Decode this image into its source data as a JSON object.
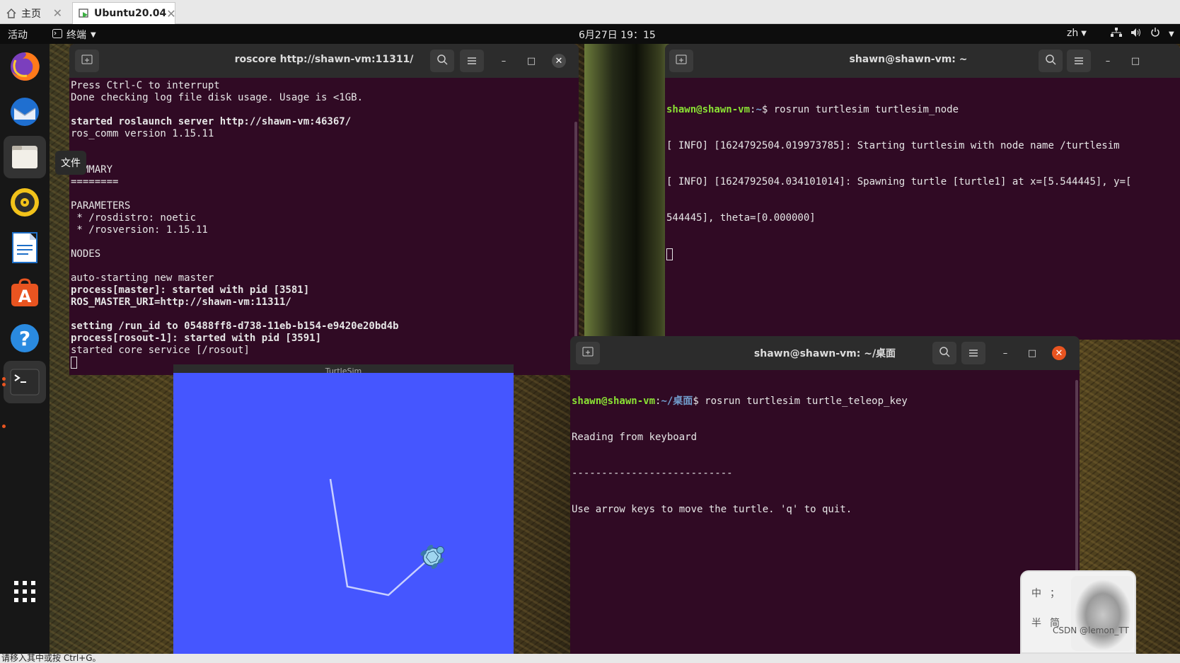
{
  "host_tabs": {
    "home_label": "主页",
    "vm_label": "Ubuntu20.04",
    "close_glyph": "✕"
  },
  "topbar": {
    "activities": "活动",
    "app_menu": "终端",
    "clock": "6月27日  19：15",
    "input_method": "zh"
  },
  "dock": {
    "tooltip": "文件",
    "items": [
      "firefox-icon",
      "thunderbird-icon",
      "files-icon",
      "rhythmbox-icon",
      "libreoffice-writer-icon",
      "ubuntu-software-icon",
      "help-icon",
      "terminal-icon",
      "show-applications-icon"
    ]
  },
  "term_roscore": {
    "title": "roscore http://shawn-vm:11311/",
    "lines": [
      {
        "t": "Press Ctrl-C to interrupt",
        "b": false
      },
      {
        "t": "Done checking log file disk usage. Usage is <1GB.",
        "b": false
      },
      {
        "t": "",
        "b": false
      },
      {
        "t": "started roslaunch server http://shawn-vm:46367/",
        "b": true
      },
      {
        "t": "ros_comm version 1.15.11",
        "b": false
      },
      {
        "t": "",
        "b": false
      },
      {
        "t": "",
        "b": false
      },
      {
        "t": "SUMMARY",
        "b": false
      },
      {
        "t": "========",
        "b": false
      },
      {
        "t": "",
        "b": false
      },
      {
        "t": "PARAMETERS",
        "b": false
      },
      {
        "t": " * /rosdistro: noetic",
        "b": false
      },
      {
        "t": " * /rosversion: 1.15.11",
        "b": false
      },
      {
        "t": "",
        "b": false
      },
      {
        "t": "NODES",
        "b": false
      },
      {
        "t": "",
        "b": false
      },
      {
        "t": "auto-starting new master",
        "b": false
      },
      {
        "t": "process[master]: started with pid [3581]",
        "b": true
      },
      {
        "t": "ROS_MASTER_URI=http://shawn-vm:11311/",
        "b": true
      },
      {
        "t": "",
        "b": false
      },
      {
        "t": "setting /run_id to 05488ff8-d738-11eb-b154-e9420e20bd4b",
        "b": true
      },
      {
        "t": "process[rosout-1]: started with pid [3591]",
        "b": true
      },
      {
        "t": "started core service [/rosout]",
        "b": false
      }
    ]
  },
  "term_node": {
    "title": "shawn@shawn-vm: ~",
    "prompt_user": "shawn@shawn-vm",
    "prompt_sep": ":",
    "prompt_path": "~",
    "prompt_end": "$ ",
    "command": "rosrun turtlesim turtlesim_node",
    "lines": [
      "[ INFO] [1624792504.019973785]: Starting turtlesim with node name /turtlesim",
      "[ INFO] [1624792504.034101014]: Spawning turtle [turtle1] at x=[5.544445], y=[",
      "544445], theta=[0.000000]"
    ]
  },
  "term_teleop": {
    "title": "shawn@shawn-vm: ~/桌面",
    "prompt_user": "shawn@shawn-vm",
    "prompt_sep": ":",
    "prompt_path": "~/桌面",
    "prompt_end": "$ ",
    "command": "rosrun turtlesim turtle_teleop_key",
    "lines": [
      "Reading from keyboard",
      "---------------------------",
      "Use arrow keys to move the turtle. 'q' to quit."
    ]
  },
  "turtlesim": {
    "title": "TurtleSim",
    "background": "#4556ff",
    "trail_color": "#c8d0ff"
  },
  "ime": {
    "k1": "中",
    "k2": "；",
    "k3": "半",
    "k4": "简"
  },
  "watermark": "CSDN @lemon_TT",
  "statusbar": "请移入其中或按 Ctrl+G。"
}
